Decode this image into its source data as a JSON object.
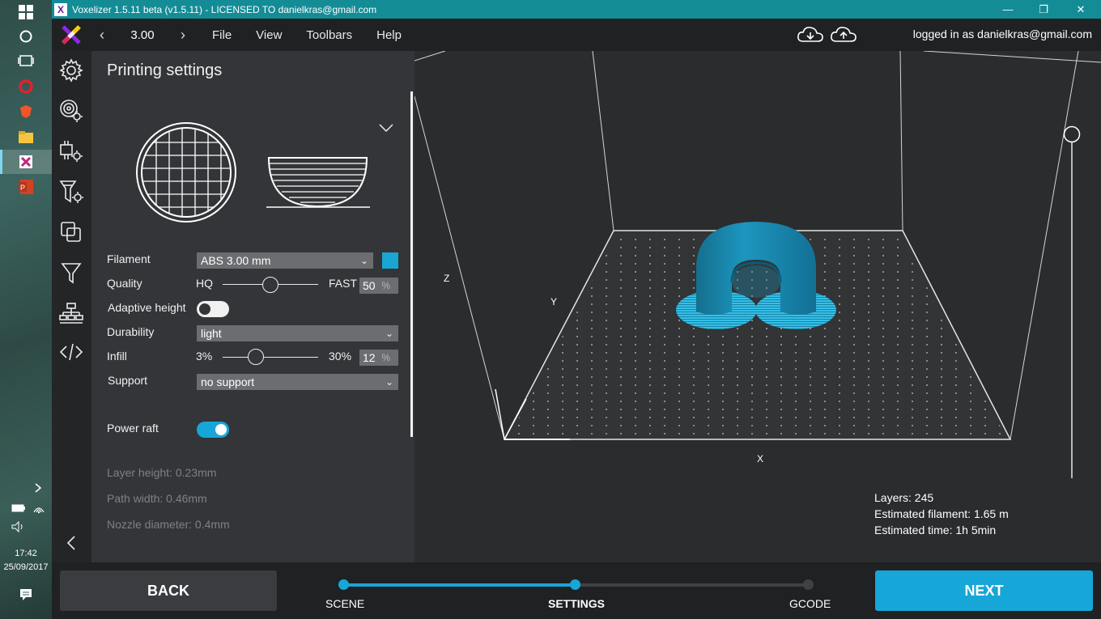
{
  "window": {
    "title": "Voxelizer 1.5.11 beta (v1.5.11) - LICENSED TO danielkras@gmail.com",
    "minimize": "—",
    "maximize": "❐",
    "close": "✕"
  },
  "toolbar": {
    "version_value": "3.00",
    "prev": "‹",
    "next": "›",
    "menus": [
      "File",
      "View",
      "Toolbars",
      "Help"
    ],
    "logged_in": "logged in as danielkras@gmail.com"
  },
  "panel": {
    "title": "Printing settings",
    "filament": {
      "label": "Filament",
      "value": "ABS 3.00 mm",
      "color": "#19a6d2"
    },
    "quality": {
      "label": "Quality",
      "min_label": "HQ",
      "max_label": "FAST",
      "value": "50",
      "unit": "%",
      "level": 0.5
    },
    "adaptive_height": {
      "label": "Adaptive height",
      "enabled": false
    },
    "durability": {
      "label": "Durability",
      "value": "light"
    },
    "infill": {
      "label": "Infill",
      "min_label": "3%",
      "max_label": "30%",
      "value": "12",
      "unit": "%",
      "level": 0.35
    },
    "support": {
      "label": "Support",
      "value": "no support"
    },
    "power_raft": {
      "label": "Power raft",
      "enabled": true
    },
    "info": {
      "layer_height": "Layer height: 0.23mm",
      "path_width": "Path width: 0.46mm",
      "nozzle_diameter": "Nozzle diameter: 0.4mm"
    }
  },
  "viewport": {
    "axis_x": "X",
    "axis_y": "Y",
    "axis_z": "Z",
    "stats": {
      "layers": "Layers: 245",
      "filament": "Estimated filament: 1.65 m",
      "time": "Estimated time: 1h 5min"
    }
  },
  "bottom": {
    "back": "BACK",
    "next": "NEXT",
    "steps": [
      "SCENE",
      "SETTINGS",
      "GCODE"
    ],
    "active_step": 1
  },
  "taskbar": {
    "time": "17:42",
    "date": "25/09/2017"
  },
  "colors": {
    "accent": "#17a6d8",
    "titlebar": "#148c96",
    "panel": "#333538",
    "model": "#1c8fb5"
  }
}
